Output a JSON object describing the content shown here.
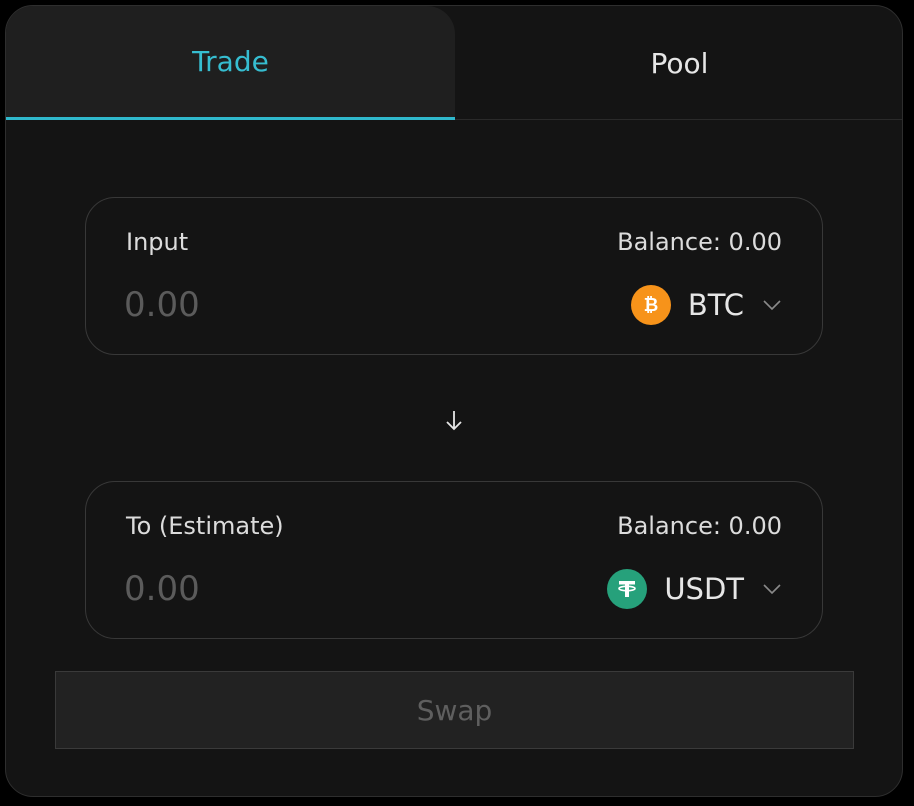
{
  "tabs": [
    {
      "label": "Trade",
      "active": true
    },
    {
      "label": "Pool",
      "active": false
    }
  ],
  "input_panel": {
    "label": "Input",
    "balance": "Balance: 0.00",
    "amount_placeholder": "0.00",
    "token": {
      "symbol": "BTC",
      "icon": "bitcoin-icon",
      "color": "#f7931a"
    }
  },
  "output_panel": {
    "label": "To (Estimate)",
    "balance": "Balance: 0.00",
    "amount_placeholder": "0.00",
    "token": {
      "symbol": "USDT",
      "icon": "tether-icon",
      "color": "#26a17b"
    }
  },
  "direction_icon": "arrow-down-icon",
  "swap_button": {
    "label": "Swap",
    "enabled": false
  },
  "colors": {
    "accent": "#2fb8cc",
    "background": "#141414",
    "active_tab_bg": "#1f1f1f"
  }
}
